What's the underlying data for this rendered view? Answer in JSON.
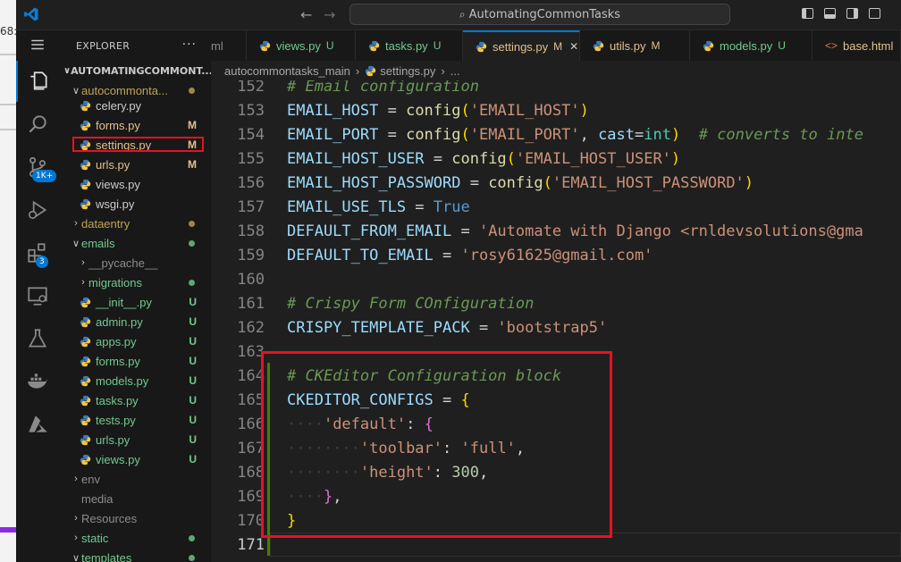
{
  "left_strip": {
    "partial_text": "68:"
  },
  "titlebar": {
    "command_center": "AutomatingCommonTasks",
    "nav_back": "←",
    "nav_forward": "→"
  },
  "activity_bar": {
    "source_control_badge": "1K+",
    "extensions_badge": "3",
    "icons": [
      "explorer-icon",
      "search-icon",
      "source-control-icon",
      "run-debug-icon",
      "extensions-icon",
      "remote-explorer-icon",
      "testing-icon",
      "docker-icon",
      "azure-icon"
    ]
  },
  "sidebar": {
    "title": "EXPLORER",
    "more": "···",
    "root_folder": "AUTOMATINGCOMMONT...",
    "items": [
      {
        "label": "autocommonta...",
        "kind": "folder-open",
        "status": "",
        "dot": "#c0a35a",
        "color": "#c0a35a"
      },
      {
        "label": "celery.py",
        "kind": "py",
        "status": "",
        "dot": "",
        "color": "#cccccc"
      },
      {
        "label": "forms.py",
        "kind": "py",
        "status": "M",
        "dot": "",
        "color": "#e2c08d"
      },
      {
        "label": "settings.py",
        "kind": "py",
        "status": "M",
        "dot": "",
        "color": "#e2c08d"
      },
      {
        "label": "urls.py",
        "kind": "py",
        "status": "M",
        "dot": "",
        "color": "#e2c08d"
      },
      {
        "label": "views.py",
        "kind": "py",
        "status": "",
        "dot": "",
        "color": "#cccccc"
      },
      {
        "label": "wsgi.py",
        "kind": "py",
        "status": "",
        "dot": "",
        "color": "#cccccc"
      },
      {
        "label": "dataentry",
        "kind": "folder",
        "status": "",
        "dot": "#c0a35a",
        "color": "#c0a35a"
      },
      {
        "label": "emails",
        "kind": "folder-open",
        "status": "",
        "dot": "#73c991",
        "color": "#73c991"
      },
      {
        "label": "__pycache__",
        "kind": "folder-sub",
        "status": "",
        "dot": "",
        "color": "#8c8c8c"
      },
      {
        "label": "migrations",
        "kind": "folder-sub",
        "status": "",
        "dot": "#73c991",
        "color": "#73c991"
      },
      {
        "label": "__init__.py",
        "kind": "py",
        "status": "U",
        "dot": "",
        "color": "#73c991"
      },
      {
        "label": "admin.py",
        "kind": "py",
        "status": "U",
        "dot": "",
        "color": "#73c991"
      },
      {
        "label": "apps.py",
        "kind": "py",
        "status": "U",
        "dot": "",
        "color": "#73c991"
      },
      {
        "label": "forms.py",
        "kind": "py",
        "status": "U",
        "dot": "",
        "color": "#73c991"
      },
      {
        "label": "models.py",
        "kind": "py",
        "status": "U",
        "dot": "",
        "color": "#73c991"
      },
      {
        "label": "tasks.py",
        "kind": "py",
        "status": "U",
        "dot": "",
        "color": "#73c991"
      },
      {
        "label": "tests.py",
        "kind": "py",
        "status": "U",
        "dot": "",
        "color": "#73c991"
      },
      {
        "label": "urls.py",
        "kind": "py",
        "status": "U",
        "dot": "",
        "color": "#73c991"
      },
      {
        "label": "views.py",
        "kind": "py",
        "status": "U",
        "dot": "",
        "color": "#73c991"
      },
      {
        "label": "env",
        "kind": "folder",
        "status": "",
        "dot": "",
        "color": "#8c8c8c"
      },
      {
        "label": "media",
        "kind": "folder-plain",
        "status": "",
        "dot": "",
        "color": "#8c8c8c"
      },
      {
        "label": "Resources",
        "kind": "folder",
        "status": "",
        "dot": "",
        "color": "#8c8c8c"
      },
      {
        "label": "static",
        "kind": "folder",
        "status": "",
        "dot": "#73c991",
        "color": "#73c991"
      },
      {
        "label": "templates",
        "kind": "folder-open",
        "status": "",
        "dot": "#73c991",
        "color": "#73c991"
      }
    ]
  },
  "tabs": [
    {
      "label": "ml",
      "status": "",
      "color": "#8c8c8c",
      "icon": "none",
      "active": false
    },
    {
      "label": "views.py",
      "status": "U",
      "color": "#73c991",
      "icon": "py",
      "active": false
    },
    {
      "label": "tasks.py",
      "status": "U",
      "color": "#73c991",
      "icon": "py",
      "active": false
    },
    {
      "label": "settings.py",
      "status": "M",
      "color": "#e2c08d",
      "icon": "py",
      "active": true
    },
    {
      "label": "utils.py",
      "status": "M",
      "color": "#e2c08d",
      "icon": "py",
      "active": false
    },
    {
      "label": "models.py",
      "status": "U",
      "color": "#73c991",
      "icon": "py",
      "active": false
    },
    {
      "label": "base.html",
      "status": "",
      "color": "#e2c08d",
      "icon": "html",
      "active": false
    }
  ],
  "tab_close": "✕",
  "breadcrumb": {
    "folder": "autocommontasks_main",
    "file": "settings.py",
    "rest": "..."
  },
  "editor": {
    "line_numbers": [
      "152",
      "153",
      "154",
      "155",
      "156",
      "157",
      "158",
      "159",
      "160",
      "161",
      "162",
      "163",
      "164",
      "165",
      "166",
      "167",
      "168",
      "169",
      "170",
      "171"
    ],
    "current_line": "171",
    "lines": {
      "l152": "# Email configuration",
      "l153_var": "EMAIL_HOST",
      "l153_fn": "config",
      "l153_str": "'EMAIL_HOST'",
      "l154_var": "EMAIL_PORT",
      "l154_fn": "config",
      "l154_str": "'EMAIL_PORT'",
      "l154_kw": "cast",
      "l154_type": "int",
      "l154_comment": "# converts to inte",
      "l155_var": "EMAIL_HOST_USER",
      "l155_fn": "config",
      "l155_str": "'EMAIL_HOST_USER'",
      "l156_var": "EMAIL_HOST_PASSWORD",
      "l156_fn": "config",
      "l156_str": "'EMAIL_HOST_PASSWORD'",
      "l157_var": "EMAIL_USE_TLS",
      "l157_val": "True",
      "l158_var": "DEFAULT_FROM_EMAIL",
      "l158_str": "'Automate with Django <rnldevsolutions@gma",
      "l159_var": "DEFAULT_TO_EMAIL",
      "l159_str": "'rosy61625@gmail.com'",
      "l161": "# Crispy Form COnfiguration",
      "l162_var": "CRISPY_TEMPLATE_PACK",
      "l162_str": "'bootstrap5'",
      "l164": "# CKEditor Configuration block",
      "l165_var": "CKEDITOR_CONFIGS",
      "l166_str": "'default'",
      "l167_str": "'toolbar'",
      "l167_val": "'full'",
      "l168_str": "'height'",
      "l168_val": "300"
    }
  }
}
